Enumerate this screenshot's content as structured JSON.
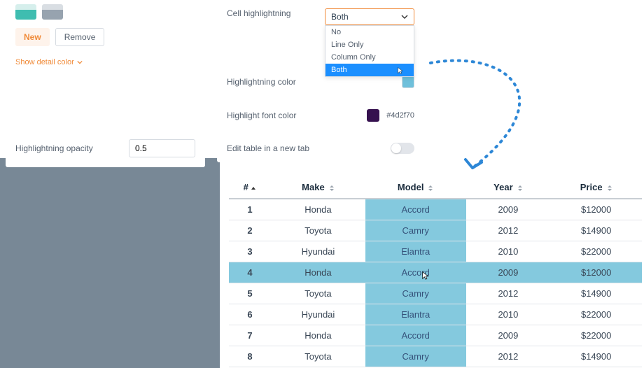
{
  "left": {
    "new_label": "New",
    "remove_label": "Remove",
    "detail_link": "Show detail color"
  },
  "opacity": {
    "label": "Highlightning opacity",
    "value": "0.5"
  },
  "settings": {
    "cell_label": "Cell highlightning",
    "cell_selected": "Both",
    "options": [
      "No",
      "Line Only",
      "Column Only",
      "Both"
    ],
    "hl_color_label": "Highlightning color",
    "hl_color_hex": "#2d8bcc",
    "font_color_label": "Highlight font color",
    "font_color_hex": "#4d2f70",
    "edit_tab_label": "Edit table in a new tab"
  },
  "table": {
    "headers": [
      "#",
      "Make",
      "Model",
      "Year",
      "Price"
    ],
    "rows": [
      {
        "n": "1",
        "make": "Honda",
        "model": "Accord",
        "year": "2009",
        "price": "$12000"
      },
      {
        "n": "2",
        "make": "Toyota",
        "model": "Camry",
        "year": "2012",
        "price": "$14900"
      },
      {
        "n": "3",
        "make": "Hyundai",
        "model": "Elantra",
        "year": "2010",
        "price": "$22000"
      },
      {
        "n": "4",
        "make": "Honda",
        "model": "Accord",
        "year": "2009",
        "price": "$12000"
      },
      {
        "n": "5",
        "make": "Toyota",
        "model": "Camry",
        "year": "2012",
        "price": "$14900"
      },
      {
        "n": "6",
        "make": "Hyundai",
        "model": "Elantra",
        "year": "2010",
        "price": "$22000"
      },
      {
        "n": "7",
        "make": "Honda",
        "model": "Accord",
        "year": "2009",
        "price": "$22000"
      },
      {
        "n": "8",
        "make": "Toyota",
        "model": "Camry",
        "year": "2012",
        "price": "$14900"
      }
    ],
    "highlight_row": 3
  }
}
